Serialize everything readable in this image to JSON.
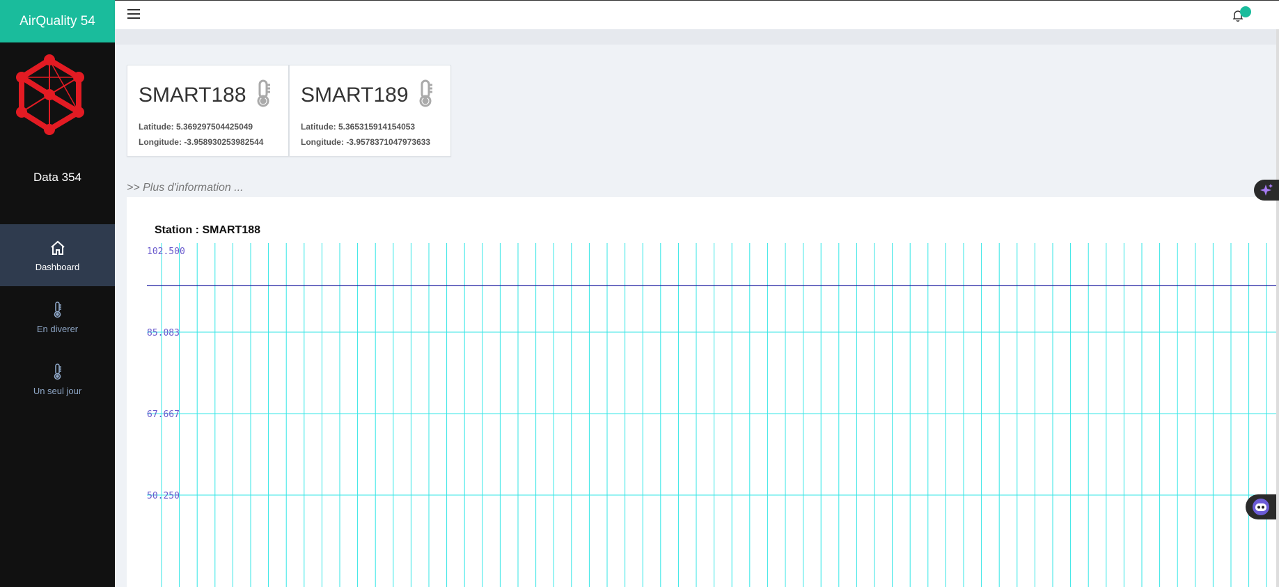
{
  "app": {
    "title": "AirQuality 54",
    "subtitle": "Data 354",
    "accent_color": "#1abc9c",
    "logo_color": "#e31b23"
  },
  "nav": {
    "items": [
      {
        "label": "Dashboard",
        "icon": "home-icon",
        "active": true
      },
      {
        "label": "En diverer",
        "icon": "thermometer-icon",
        "active": false
      },
      {
        "label": "Un seul jour",
        "icon": "thermometer-icon",
        "active": false
      }
    ]
  },
  "topbar": {
    "menu_icon": "hamburger-icon",
    "notification_icon": "bell-icon"
  },
  "stations": [
    {
      "name": "SMART188",
      "latitude": "Latitude: 5.369297504425049",
      "longitude": "Longitude: -3.958930253982544",
      "icon": "thermometer-icon"
    },
    {
      "name": "SMART189",
      "latitude": "Latitude: 5.365315914154053",
      "longitude": "Longitude: -3.9578371047973633",
      "icon": "thermometer-icon"
    }
  ],
  "more_info": ">> Plus d'information ...",
  "chart_data": {
    "type": "line",
    "title": "Station : SMART188",
    "y_ticks": [
      "102.500",
      "85.083",
      "67.667",
      "50.250"
    ],
    "series": [
      {
        "values": [
          95,
          95,
          95,
          95,
          95,
          95,
          95,
          95,
          95,
          95
        ],
        "color": "#1a1aa0"
      }
    ],
    "grid_color": "#33e6e6",
    "tick_color": "#6a5acd",
    "grid": true
  }
}
